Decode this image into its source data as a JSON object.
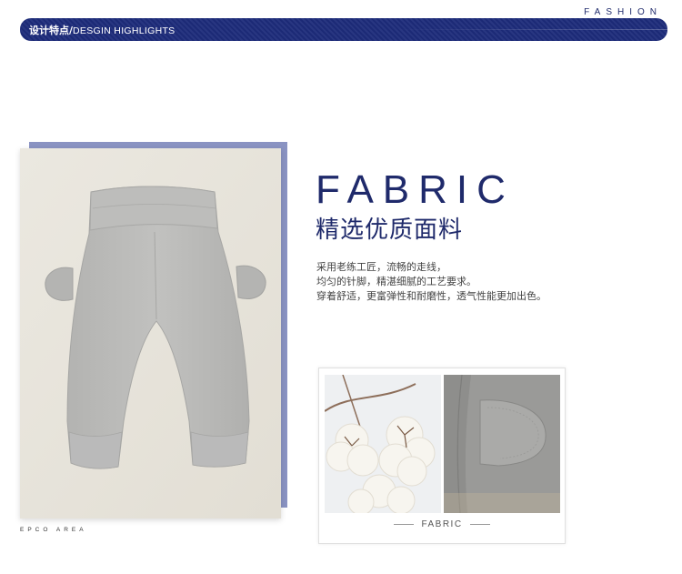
{
  "top_right_tag": "FASHION",
  "header": {
    "title_cn": "设计特点/",
    "title_en": "DESGIN HIGHLIGHTS"
  },
  "product_photo": {
    "caption": "EPCO AREA"
  },
  "section": {
    "title_en": "FABRIC",
    "title_cn": "精选优质面料",
    "description_lines": [
      "采用老练工匠，流畅的走线，",
      "均匀的针脚，精湛细腻的工艺要求。",
      "穿着舒适，更富弹性和耐磨性，透气性能更加出色。"
    ]
  },
  "detail_card": {
    "caption": "FABRIC",
    "images": [
      "cotton-bolls",
      "fabric-ear-detail"
    ]
  },
  "colors": {
    "brand_navy": "#1d2b7a",
    "frame_periwinkle": "#8a93c2",
    "photo_background": "#e8e5dc",
    "garment_gray": "#b9b9b7"
  }
}
